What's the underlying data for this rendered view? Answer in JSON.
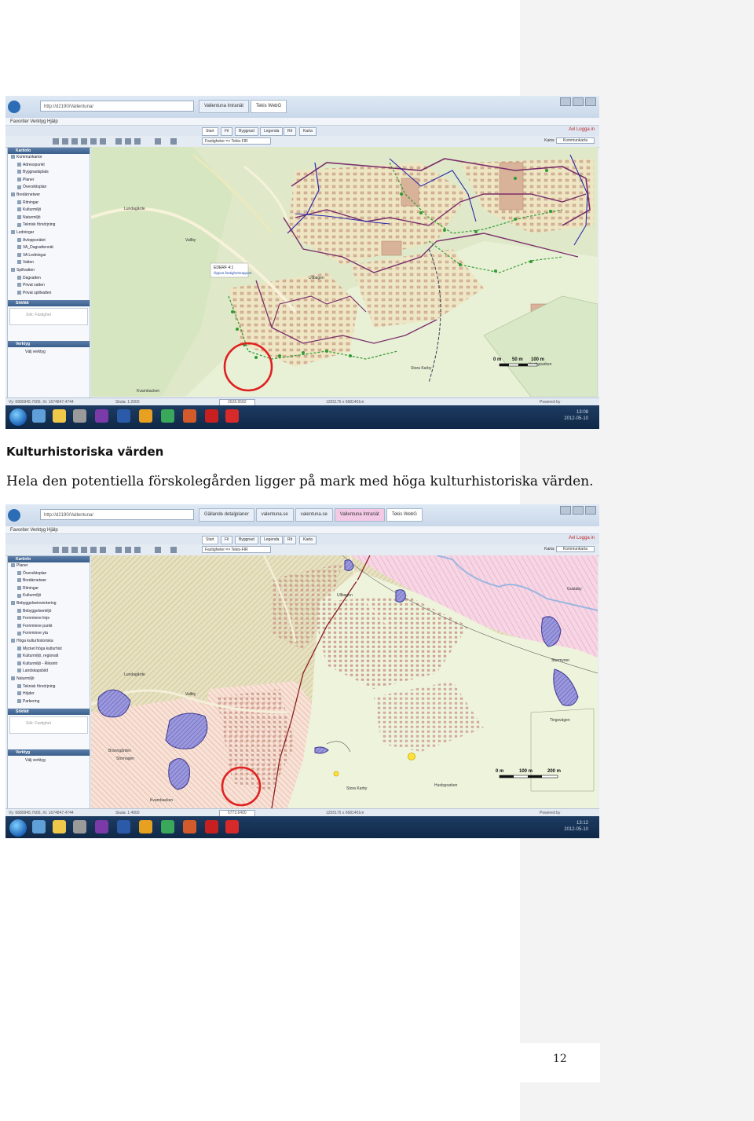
{
  "heading": "Kulturhistoriska värden",
  "paragraph": "Hela den potentiella förskolegården ligger på mark med höga kulturhistoriska värden.",
  "page_number": "12",
  "shot1": {
    "address": "http://d2190/Vallentuna/",
    "tabs": [
      "Vallentuna Intranät",
      "Tekis WebG"
    ],
    "menu": "Favoriter  Verktyg  Hjälp",
    "app_tabs": [
      "Start",
      "Fil",
      "Byggnad",
      "Legenda",
      "Rit",
      "Karta"
    ],
    "login": "Avl  Logga in",
    "layer_field": "Fastigheter => Tekis-FIR",
    "basemap_label": "Karta:",
    "basemap_value": "Kommunkarta",
    "sidebar_title": "Kartinfo",
    "layers": [
      "Kommunkartor",
      "Adresspunkt",
      "Byggnadsplats",
      "Planer",
      "Översiktsplan",
      "Bredärnetwer",
      "Ritningar",
      "Kulturmiljö",
      "Naturmiljö",
      "Teknisk försörjning",
      "Ledningar",
      "Avloppsnätet",
      "VA_Dagvattennät",
      "VA Ledningar",
      "Vatten",
      "Spillvatten",
      "Dagvatten",
      "Privat vatten",
      "Privat spillvatten"
    ],
    "search_title": "Sökfält",
    "search_placeholder": "Sök: Fastighet",
    "tools_title": "Verktyg",
    "tools_value": "Välj verktyg",
    "map_labels": {
      "lundagarde": "Lundagårde",
      "vallby": "Vallby",
      "uppgift": "EDERF 4:1",
      "uppgift_link": "Öppna fastighetsrapport",
      "ullbagen": "Ullbagen",
      "stora_karby": "Stora Karby",
      "kvarnbacken": "Kvarnbacken",
      "husbyparken": "Husbyparken"
    },
    "scale_labels": [
      "0 m",
      "50 m",
      "100 m"
    ],
    "coord": "2628.9582",
    "status_left": "Vy: 6680945.7600, Xt: 1674847.4744",
    "status_mid": "Skala: 1:2000",
    "status_right": "1255175 x 6681401m",
    "powered": "Powered by",
    "clock": [
      "13:08",
      "2012-05-10"
    ]
  },
  "shot2": {
    "address": "http://d2190/Vallentuna/",
    "tabs": [
      "Gällande detaljplaner",
      "valentuna.se",
      "valentuna.se",
      "Vallentuna Intranät",
      "Tekis WebG"
    ],
    "menu": "Favoriter  Verktyg  Hjälp",
    "app_tabs": [
      "Start",
      "Fil",
      "Byggnad",
      "Legenda",
      "Rit",
      "Karta"
    ],
    "login": "Avl  Logga in",
    "layer_field": "Fastigheter => Tekis-FIR",
    "basemap_label": "Karta:",
    "basemap_value": "Kommunkarta",
    "sidebar_title": "Kartinfo",
    "layers": [
      "Planer",
      "Översiktsplan",
      "Bredärnetwer",
      "Ritningar",
      "Kulturmiljö",
      "Bebyggelseinventering",
      "Bebyggelsemiljö",
      "Fornminne linje",
      "Fornminne punkt",
      "Fornminne yta",
      "Höga kulturhistoriska",
      "Mycket höga kulturhist",
      "Kulturmiljö, regionalt",
      "Kulturmiljö - Riksintr",
      "Landskapsbild",
      "Naturmiljö",
      "Teknisk försörjning",
      "Höjder",
      "Parkering"
    ],
    "search_title": "Sökfält",
    "search_placeholder": "Sök: Fastighet",
    "tools_title": "Verktyg",
    "tools_value": "Välj verktyg",
    "map_labels": {
      "lundagarde": "Lundagårde",
      "vallby": "Vallby",
      "ullbagen": "Ullbagen",
      "stora_karby": "Stora Karby",
      "kvarnbacken": "Kvarnbacken",
      "husbyparken": "Husbyparken",
      "brannagen": "Bränngården",
      "storvagen": "Stornagen",
      "stormyren": "Stormyren",
      "tingsvagen": "Tingsvägen",
      "gustaby": "Gustaby"
    },
    "scale_labels": [
      "0 m",
      "100 m",
      "200 m"
    ],
    "coord": "5773.6400",
    "status_left": "Vy: 6680945.7600, Xt: 1674847.4744",
    "status_mid": "Skala: 1:4000",
    "status_right": "1255175 x 6681401m",
    "powered": "Powered by",
    "clock": [
      "13:12",
      "2012-05-10"
    ]
  },
  "colors": {
    "highlight_circle": "#e02020",
    "road": "#7a2e6a",
    "pipe": "#2a2aa8",
    "node": "#2f9a32",
    "heritage_hatch": "#e9a08f",
    "ancient_area": "#7b78c9"
  }
}
